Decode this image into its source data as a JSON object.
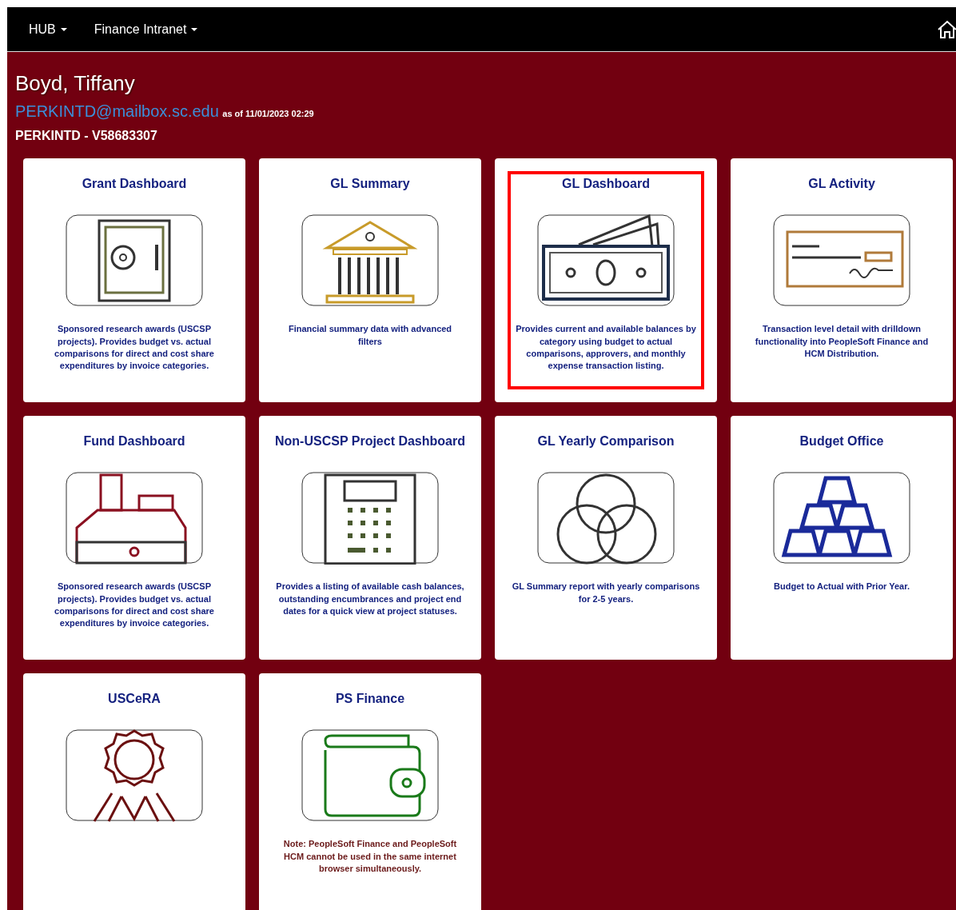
{
  "navbar": {
    "menus": [
      {
        "label": "HUB"
      },
      {
        "label": "Finance Intranet"
      }
    ]
  },
  "user": {
    "name": "Boyd, Tiffany",
    "email": "PERKINTD@mailbox.sc.edu",
    "as_of": "as of 11/01/2023 02:29",
    "id_line": "PERKINTD - V58683307"
  },
  "cards": [
    {
      "title": "Grant Dashboard",
      "description": "Sponsored research awards (USCSP projects). Provides budget vs. actual comparisons for direct and cost share expenditures by invoice categories.",
      "kind": "description",
      "highlighted": false
    },
    {
      "title": "GL Summary",
      "description": "Financial summary data with advanced filters",
      "kind": "description",
      "highlighted": false
    },
    {
      "title": "GL Dashboard",
      "description": "Provides current and available balances by category using budget to actual comparisons, approvers, and monthly expense transaction listing.",
      "kind": "description",
      "highlighted": true
    },
    {
      "title": "GL Activity",
      "description": "Transaction level detail with drilldown functionality into PeopleSoft Finance and HCM Distribution.",
      "kind": "description",
      "highlighted": false
    },
    {
      "title": "Fund Dashboard",
      "description": "Sponsored research awards (USCSP projects). Provides budget vs. actual comparisons for direct and cost share expenditures by invoice categories.",
      "kind": "description",
      "highlighted": false
    },
    {
      "title": "Non-USCSP Project Dashboard",
      "description": "Provides a listing of available cash balances, outstanding encumbrances and project end dates for a quick view at project statuses.",
      "kind": "description",
      "highlighted": false
    },
    {
      "title": "GL Yearly Comparison",
      "description": "GL Summary report with yearly comparisons for 2-5 years.",
      "kind": "description",
      "highlighted": false
    },
    {
      "title": "Budget Office",
      "description": "Budget to Actual with Prior Year.",
      "kind": "description",
      "highlighted": false
    },
    {
      "title": "USCeRA",
      "highlighted": false
    },
    {
      "title": "PS Finance",
      "description": "Note: PeopleSoft Finance and PeopleSoft HCM cannot be used in the same internet browser simultaneously.",
      "kind": "note",
      "highlighted": false
    }
  ]
}
